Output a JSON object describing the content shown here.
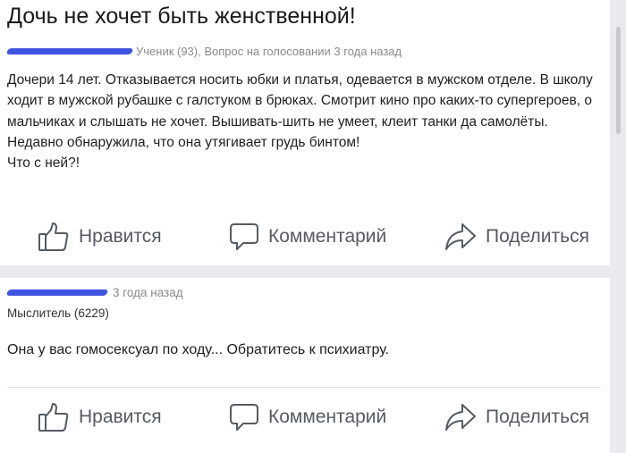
{
  "question": {
    "title": "Дочь не хочет быть женственной!",
    "meta": "Ученик (93), Вопрос на голосовании 3 года назад",
    "paragraphs": [
      "Дочери 14 лет. Отказывается носить юбки и платья, одевается в мужском отделе. В школу ходит в мужской рубашке с галстуком в брюках. Смотрит кино про каких-то супергероев, о мальчиках и слышать не хочет. Вышивать-шить не умеет, клеит танки да самолёты.",
      "Недавно обнаружила, что она утягивает грудь бинтом!",
      "Что с ней?!"
    ],
    "actions": {
      "like": "Нравится",
      "comment": "Комментарий",
      "share": "Поделиться"
    }
  },
  "answer": {
    "time": "3 года назад",
    "rank": "Мыслитель (6229)",
    "text": "Она у вас гомосексуал по ходу... Обратитесь к психиатру.",
    "actions": {
      "like": "Нравится",
      "comment": "Комментарий",
      "share": "Поделиться"
    }
  },
  "colors": {
    "redaction": "#3f55e0",
    "action_text": "#555b62",
    "background": "#e9e9ee"
  },
  "icons": [
    "thumbs-up-icon",
    "speech-bubble-icon",
    "share-arrow-icon"
  ]
}
